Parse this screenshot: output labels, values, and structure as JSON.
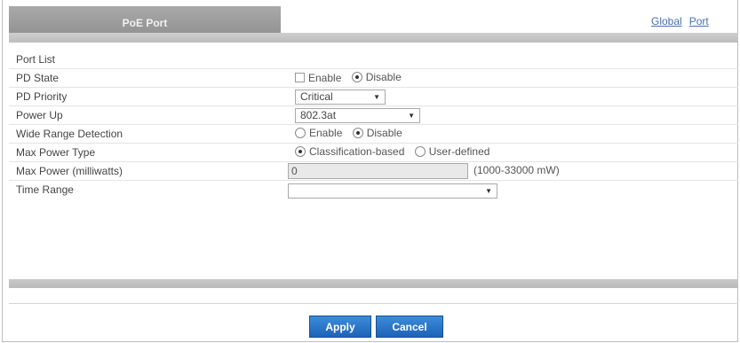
{
  "panel": {
    "title": "PoE Port"
  },
  "nav": {
    "global_label": "Global",
    "port_label": "Port"
  },
  "form": {
    "port_list": {
      "label": "Port List"
    },
    "pd_state": {
      "label": "PD State",
      "options": [
        "Enable",
        "Disable"
      ],
      "selected": "Disable"
    },
    "pd_priority": {
      "label": "PD Priority",
      "value": "Critical"
    },
    "power_up": {
      "label": "Power Up",
      "value": "802.3at"
    },
    "wide_range_detection": {
      "label": "Wide Range Detection",
      "options": [
        "Enable",
        "Disable"
      ],
      "selected": "Disable"
    },
    "max_power_type": {
      "label": "Max Power Type",
      "options": [
        "Classification-based",
        "User-defined"
      ],
      "selected": "Classification-based"
    },
    "max_power_milliwatts": {
      "label": "Max Power (milliwatts)",
      "value": "0",
      "range": "(1000-33000 mW)"
    },
    "time_range": {
      "label": "Time Range",
      "value": ""
    }
  },
  "buttons": {
    "apply": "Apply",
    "cancel": "Cancel"
  },
  "colors": {
    "caption_bg": "#999999",
    "button_bg": "#2a74c9",
    "link": "#4a6fb0"
  }
}
